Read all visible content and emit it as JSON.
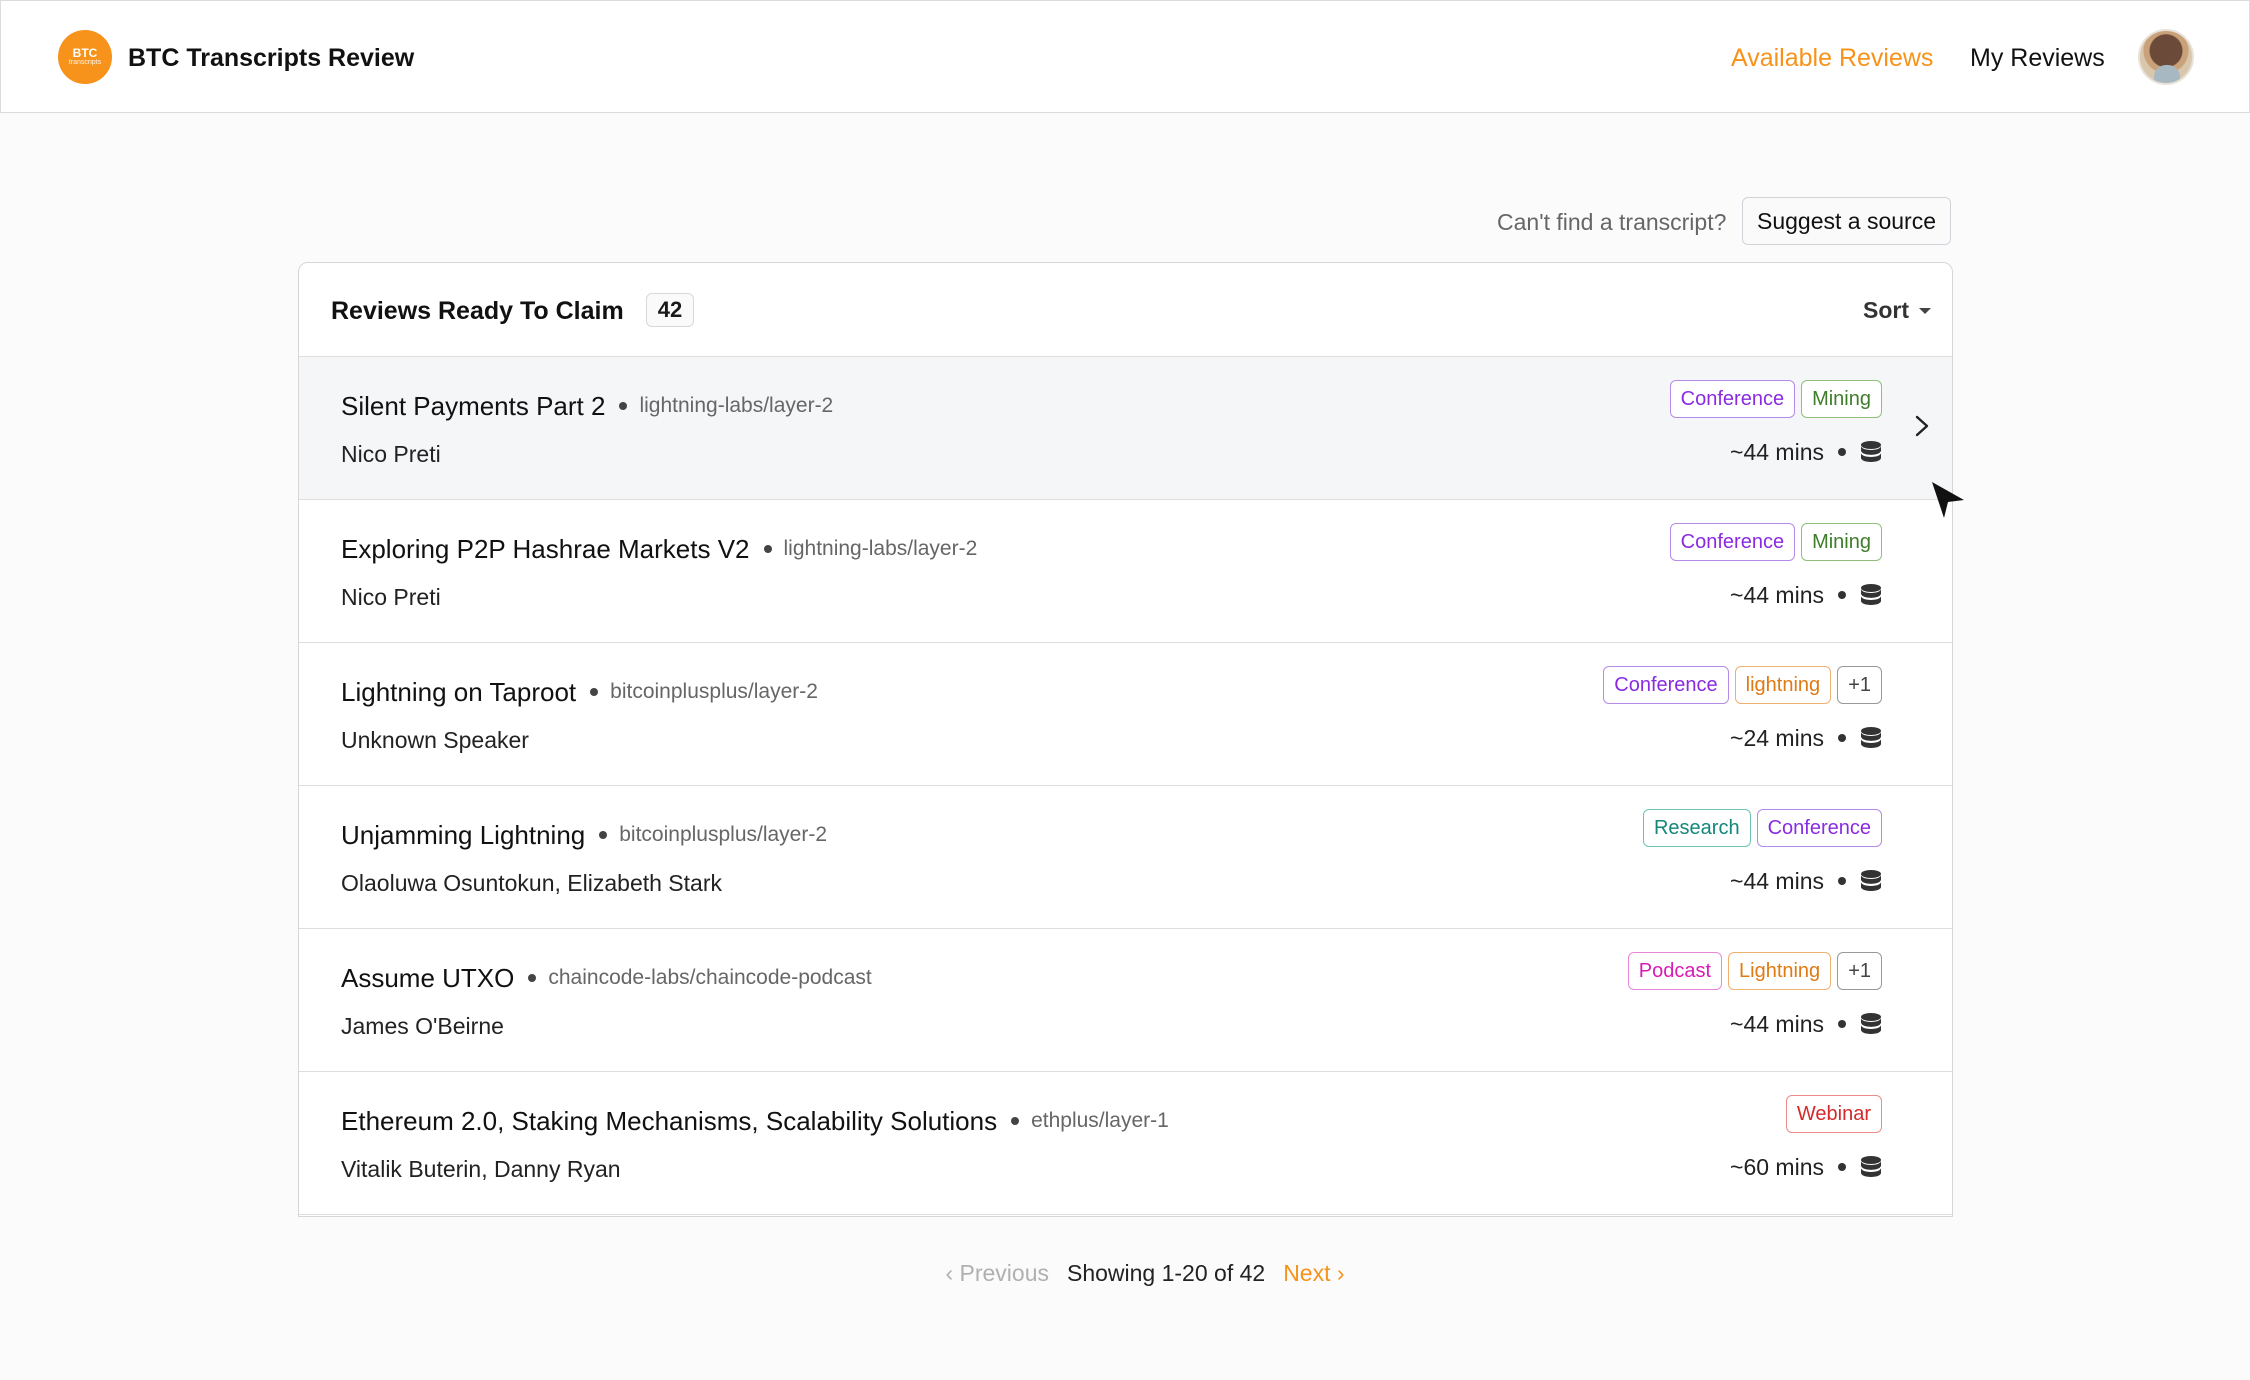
{
  "header": {
    "logo_line1": "BTC",
    "logo_line2": "transcripts",
    "app_title": "BTC Transcripts Review",
    "nav": {
      "available_reviews": "Available Reviews",
      "my_reviews": "My Reviews"
    },
    "accent_color": "#f7931a"
  },
  "suggest": {
    "prompt": "Can't find a transcript?",
    "button_label": "Suggest a source"
  },
  "list": {
    "title": "Reviews Ready To Claim",
    "count": "42",
    "sort_label": "Sort",
    "rows": [
      {
        "title": "Silent Payments Part 2",
        "source": "lightning-labs/layer-2",
        "speakers": "Nico Preti",
        "tags": [
          "Conference",
          "Mining"
        ],
        "duration": "~44 mins"
      },
      {
        "title": "Exploring P2P Hashrae Markets V2",
        "source": "lightning-labs/layer-2",
        "speakers": "Nico Preti",
        "tags": [
          "Conference",
          "Mining"
        ],
        "duration": "~44 mins"
      },
      {
        "title": "Lightning on Taproot",
        "source": "bitcoinplusplus/layer-2",
        "speakers": "Unknown Speaker",
        "tags": [
          "Conference",
          "lightning",
          "+1"
        ],
        "duration": "~24 mins"
      },
      {
        "title": "Unjamming Lightning",
        "source": "bitcoinplusplus/layer-2",
        "speakers": "Olaoluwa Osuntokun, Elizabeth Stark",
        "tags": [
          "Research",
          "Conference"
        ],
        "duration": "~44 mins"
      },
      {
        "title": "Assume UTXO",
        "source": "chaincode-labs/chaincode-podcast",
        "speakers": "James O'Beirne",
        "tags": [
          "Podcast",
          "Lightning",
          "+1"
        ],
        "duration": "~44 mins"
      },
      {
        "title": "Ethereum 2.0, Staking Mechanisms, Scalability Solutions",
        "source": "ethplus/layer-1",
        "speakers": "Vitalik Buterin, Danny Ryan",
        "tags": [
          "Webinar"
        ],
        "duration": "~60 mins"
      }
    ]
  },
  "pagination": {
    "previous": "Previous",
    "info": "Showing 1-20 of 42",
    "next": "Next"
  }
}
